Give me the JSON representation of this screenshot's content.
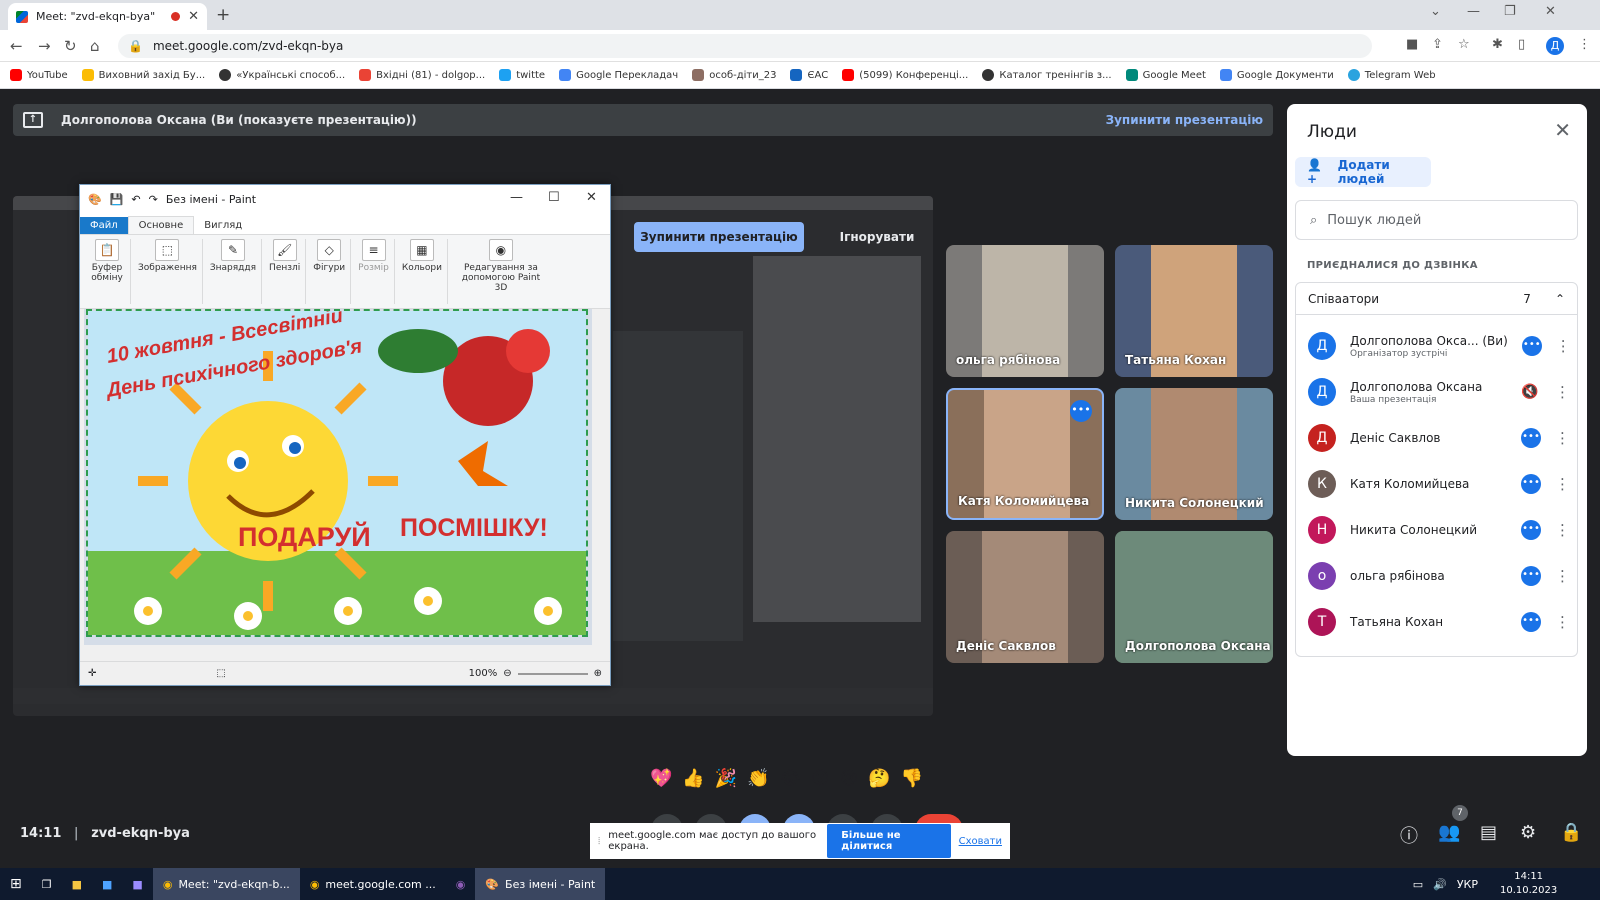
{
  "browser": {
    "tab_title": "Meet: \"zvd-ekqn-bya\"",
    "url": "meet.google.com/zvd-ekqn-bya",
    "profile_initial": "Д",
    "bookmarks": [
      {
        "label": "YouTube",
        "color": "#ff0000"
      },
      {
        "label": "Виховний захід Бу...",
        "color": "#fbbc04"
      },
      {
        "label": "«Українські способ...",
        "color": "#333333"
      },
      {
        "label": "Вхідні (81) - dolgop...",
        "color": "#ea4335"
      },
      {
        "label": "twitte",
        "color": "#1da1f2"
      },
      {
        "label": "Google Перекладач",
        "color": "#4285f4"
      },
      {
        "label": "особ-діти_23",
        "color": "#8d6e63"
      },
      {
        "label": "ЄАС",
        "color": "#1565c0"
      },
      {
        "label": "(5099) Конференці...",
        "color": "#ff0000"
      },
      {
        "label": "Каталог тренінгів з...",
        "color": "#333333"
      },
      {
        "label": "Google Meet",
        "color": "#00897b"
      },
      {
        "label": "Google Документи",
        "color": "#4285f4"
      },
      {
        "label": "Telegram Web",
        "color": "#2aa3df"
      }
    ]
  },
  "meet": {
    "presenting_banner": "Долгополова Оксана (Ви (показуєте презентацію))",
    "stop_presenting": "Зупинити презентацію",
    "stop_presenting_btn": "Зупинити презентацію",
    "ignore_btn": "Ігнорувати",
    "meeting_time": "14:11",
    "meeting_code": "zvd-ekqn-bya",
    "participant_badge": "7",
    "reactions": [
      "💖",
      "👍",
      "🎉",
      "👏",
      "😂",
      "😮",
      "😢",
      "🤔",
      "👎"
    ],
    "tiles": [
      {
        "name": "ольга рябінова",
        "bg": "#7c7a78"
      },
      {
        "name": "Татьяна Кохан",
        "bg": "#4a5a7a"
      },
      {
        "name": "Катя Коломийцева",
        "bg": "#8a6f5a"
      },
      {
        "name": "Никита Солонецкий",
        "bg": "#6a8aa0"
      },
      {
        "name": "Деніс Саквлов",
        "bg": "#6b5d55"
      },
      {
        "name": "Долгополова Оксана",
        "bg": "#4f6b55"
      }
    ]
  },
  "paint": {
    "title": "Без імені - Paint",
    "menu_file": "Файл",
    "menu_home": "Основне",
    "menu_view": "Вигляд",
    "groups": [
      {
        "label": "Буфер обміну",
        "icon": "📋"
      },
      {
        "label": "Зображення",
        "icon": "⬚"
      },
      {
        "label": "Знаряддя",
        "icon": "✎"
      },
      {
        "label": "Пензлі",
        "icon": "🖌"
      },
      {
        "label": "Фігури",
        "icon": "◇"
      },
      {
        "label": "Розмір",
        "icon": "≡"
      },
      {
        "label": "Кольори",
        "icon": "▦"
      },
      {
        "label": "Редагування за допомогою Paint 3D",
        "icon": "◉"
      }
    ],
    "zoom": "100%",
    "poster_line1": "10 жовтня - Всесвітній",
    "poster_line2": "День психічного здоров'я",
    "poster_word1": "ПОДАРУЙ",
    "poster_word2": "ПОСМІШКУ!"
  },
  "people": {
    "title": "Люди",
    "add_people": "Додати людей",
    "search_placeholder": "Пошук людей",
    "joined_heading": "ПРИЄДНАЛИСЯ ДО ДЗВІНКА",
    "group_label": "Співаатори",
    "group_count": "7",
    "list": [
      {
        "initial": "Д",
        "name": "Долгополова Окса...  (Ви)",
        "sub": "Організатор зустрічі",
        "color": "#1a73e8"
      },
      {
        "initial": "Д",
        "name": "Долгополова Оксана",
        "sub": "Ваша презентація",
        "color": "#1a73e8"
      },
      {
        "initial": "Д",
        "name": "Деніс Саквлов",
        "sub": "",
        "color": "#c5221f"
      },
      {
        "initial": "К",
        "name": "Катя Коломийцева",
        "sub": "",
        "color": "#6d5d57"
      },
      {
        "initial": "Н",
        "name": "Никита Солонецкий",
        "sub": "",
        "color": "#c2185b"
      },
      {
        "initial": "о",
        "name": "ольга рябінова",
        "sub": "",
        "color": "#7b3fb0"
      },
      {
        "initial": "Т",
        "name": "Татьяна Кохан",
        "sub": "",
        "color": "#ad1457"
      }
    ]
  },
  "share_notice": {
    "text": "meet.google.com має доступ до вашого екрана.",
    "stop_sharing": "Більше не ділитися",
    "hide": "Сховати"
  },
  "taskbar": {
    "items": [
      "Meet: \"zvd-ekqn-b...",
      "meet.google.com ...",
      "Без імені - Paint"
    ],
    "lang": "УКР",
    "time": "14:11",
    "date": "10.10.2023"
  }
}
